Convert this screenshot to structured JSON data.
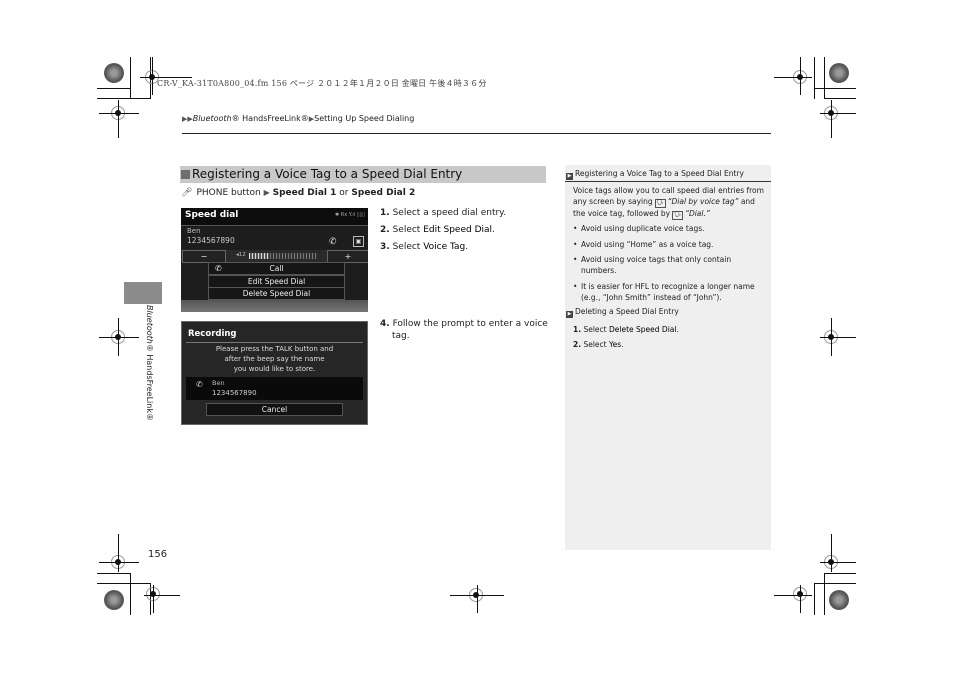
{
  "print_header": "CR-V_KA-31T0A800_04.fm  156 ページ  ２０１２年１月２０日  金曜日  午後４時３６分",
  "breadcrumb": {
    "arrows": "▶▶",
    "part1": "Bluetooth",
    "part1_suffix": "® HandsFreeLink®",
    "separator": "▶",
    "part2": "Setting Up Speed Dialing"
  },
  "side_tab": {
    "italic": "Bluetooth",
    "rest": "® HandsFreeLink®"
  },
  "section": {
    "title": "Registering a Voice Tag to a Speed Dial Entry",
    "path_icon": "phone-button-icon",
    "path_prefix": "PHONE button",
    "path_arrow": "▶",
    "path_item1": "Speed Dial 1",
    "path_or": "or",
    "path_item2": "Speed Dial 2"
  },
  "screen1": {
    "title": "Speed dial",
    "status": "✱ Rx Y.ıl ▯▯▯",
    "entry_name": "Ben",
    "entry_number": "1234567890",
    "volume_label": "◂12",
    "volume_level": 0.3,
    "minus": "−",
    "plus": "+",
    "buttons": [
      "Call",
      "Edit Speed Dial",
      "Delete Speed Dial"
    ]
  },
  "screen2": {
    "title": "Recording",
    "message": [
      "Please press the TALK button and",
      "after the beep say the name",
      "you would like to store."
    ],
    "entry_name": "Ben",
    "entry_number": "1234567890",
    "cancel": "Cancel"
  },
  "steps": [
    {
      "num": "1.",
      "pre": "Select a speed dial entry.",
      "bold": "",
      "post": ""
    },
    {
      "num": "2.",
      "pre": "Select ",
      "bold": "Edit Speed Dial",
      "post": "."
    },
    {
      "num": "3.",
      "pre": "Select ",
      "bold": "Voice Tag",
      "post": "."
    },
    {
      "num": "4.",
      "line1": "Follow the prompt to enter a voice",
      "line2": "tag."
    }
  ],
  "sidebar_note": {
    "heading": "Registering a Voice Tag to a Speed Dial Entry",
    "intro_1": "Voice tags allow you to call speed dial entries from any screen by saying",
    "voice_cmd_1": "“Dial by voice tag”",
    "intro_2": "and the voice tag, followed by",
    "voice_cmd_2": "“Dial.”",
    "bullets": [
      "Avoid using duplicate voice tags.",
      "Avoid using “Home” as a voice tag.",
      "Avoid using voice tags that only contain numbers.",
      "It is easier for HFL to recognize a longer name (e.g., “John Smith” instead of “John”)."
    ],
    "heading2": "Deleting a Speed Dial Entry",
    "steps2": [
      {
        "num": "1.",
        "pre": "Select ",
        "bold": "Delete Speed Dial",
        "post": "."
      },
      {
        "num": "2.",
        "pre": "Select ",
        "bold": "Yes",
        "post": "."
      }
    ]
  },
  "page_number": "156"
}
